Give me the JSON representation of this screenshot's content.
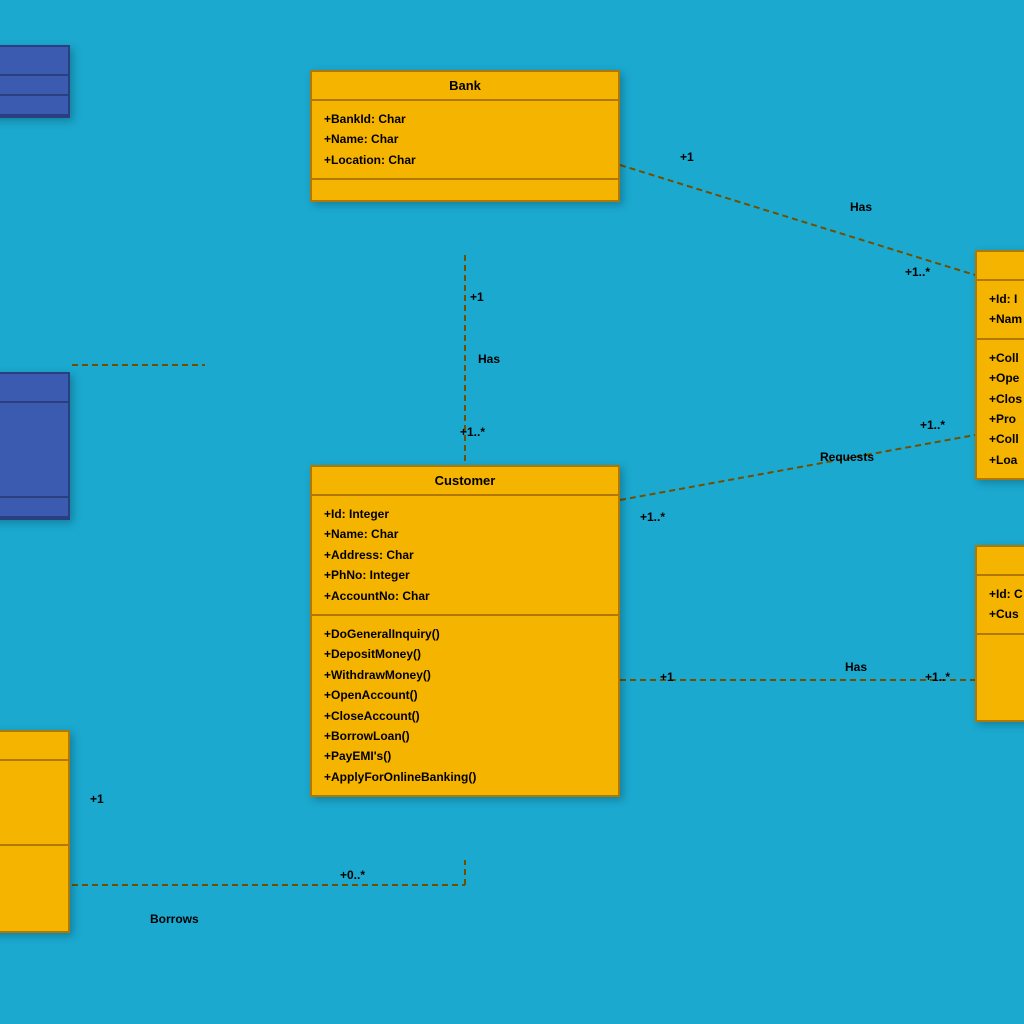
{
  "classes": {
    "bank": {
      "name": "Bank",
      "attributes": [
        "+BankId: Char",
        "+Name: Char",
        "+Location: Char"
      ]
    },
    "customer": {
      "name": "Customer",
      "attributes": [
        "+Id: Integer",
        "+Name: Char",
        "+Address: Char",
        "+PhNo: Integer",
        "+AccountNo: Char"
      ],
      "methods": [
        "+DoGeneralInquiry()",
        "+DepositMoney()",
        "+WithdrawMoney()",
        "+OpenAccount()",
        "+CloseAccount()",
        "+BorrowLoan()",
        "+PayEMI's()",
        "+ApplyForOnlineBanking()"
      ]
    },
    "rightTop": {
      "attributes": [
        "+Id: I",
        "+Nam"
      ],
      "methods": [
        "+Coll",
        "+Ope",
        "+Clos",
        "+Pro",
        "+Coll",
        "+Loa"
      ]
    },
    "rightBottom": {
      "attributes": [
        "+Id: C",
        "+Cus"
      ]
    }
  },
  "relations": {
    "bank_has_customer": {
      "label": "Has",
      "mult1": "+1",
      "mult2": "+1..*"
    },
    "bank_has_right": {
      "label": "Has",
      "mult1": "+1",
      "mult2": "+1..*"
    },
    "customer_requests": {
      "label": "Requests",
      "mult1": "+1..*",
      "mult2": "+1..*"
    },
    "customer_has_right": {
      "label": "Has",
      "mult1": "+1",
      "mult2": "+1..*"
    },
    "borrows": {
      "label": "Borrows",
      "mult1": "+1",
      "mult2": "+0..*"
    }
  }
}
